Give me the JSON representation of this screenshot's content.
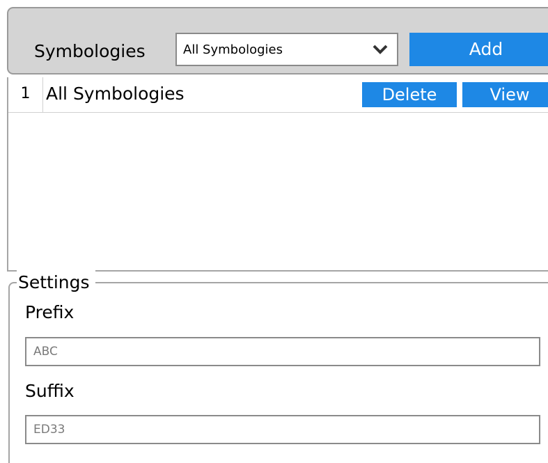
{
  "toolbar": {
    "label": "Symbologies",
    "select_value": "All Symbologies",
    "add_label": "Add"
  },
  "table": {
    "rows": [
      {
        "index": "1",
        "name": "All Symbologies",
        "delete_label": "Delete",
        "view_label": "View"
      }
    ]
  },
  "settings": {
    "legend": "Settings",
    "prefix_label": "Prefix",
    "prefix_value": "ABC",
    "suffix_label": "Suffix",
    "suffix_value": "ED33"
  },
  "icons": {
    "dropdown": "chevron-down-icon"
  },
  "colors": {
    "accent": "#1e88e5",
    "toolbar_bg": "#d4d4d4"
  }
}
